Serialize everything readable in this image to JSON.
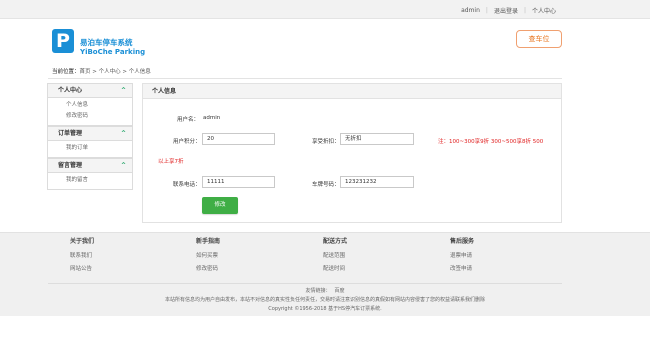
{
  "topbar": {
    "user": "admin",
    "logout": "退出登录",
    "center": "个人中心"
  },
  "brand": {
    "logo_letter": "P",
    "name_cn": "易泊车停车系统",
    "name_en": "YiBoChe  Parking",
    "color": "#1a8fd6"
  },
  "header": {
    "find_button": "查车位"
  },
  "breadcrumb": {
    "label": "当前位置：",
    "path": "首页 > 个人中心 > 个人信息"
  },
  "sidebar": {
    "groups": [
      {
        "title": "个人中心",
        "items": [
          "个人信息",
          "修改密码"
        ]
      },
      {
        "title": "订单管理",
        "items": [
          "我的订单"
        ]
      },
      {
        "title": "留言管理",
        "items": [
          "我的留言"
        ]
      }
    ]
  },
  "panel": {
    "title": "个人信息",
    "username_label": "用户名：",
    "username_value": "admin",
    "points_label": "用户积分：",
    "points_value": "20",
    "discount_label": "享受折扣：",
    "discount_value": "无折扣",
    "note_line1": "注：100~300享9折 300~500享8折 500",
    "note_line2": "以上享7折",
    "phone_label": "联系电话：",
    "phone_value": "11111",
    "plate_label": "车牌号码：",
    "plate_value": "123231232",
    "submit_label": "修改"
  },
  "footer": {
    "columns": [
      {
        "title": "关于我们",
        "links": [
          "联系我们",
          "网站公告"
        ]
      },
      {
        "title": "新手指南",
        "links": [
          "如何买票",
          "修改密码"
        ]
      },
      {
        "title": "配送方式",
        "links": [
          "配送范围",
          "配送时间"
        ]
      },
      {
        "title": "售后服务",
        "links": [
          "退票申请",
          "改签申请"
        ]
      }
    ],
    "friend_links_label": "友情链接：",
    "friend_link": "百度",
    "disclaimer": "本站所有信息均为用户自由发布，本站不对信息的真实性负任何责任，交易时请注意识别信息的真假如有网站内容侵害了您的权益请联系我们删除",
    "copyright": "Copyright ©1956-2018 基于HS停汽车订票系统."
  },
  "colors": {
    "accent_green": "#3fae45",
    "chevron_green": "#17a060",
    "note_red": "#e02020",
    "find_orange": "#e8741e"
  }
}
